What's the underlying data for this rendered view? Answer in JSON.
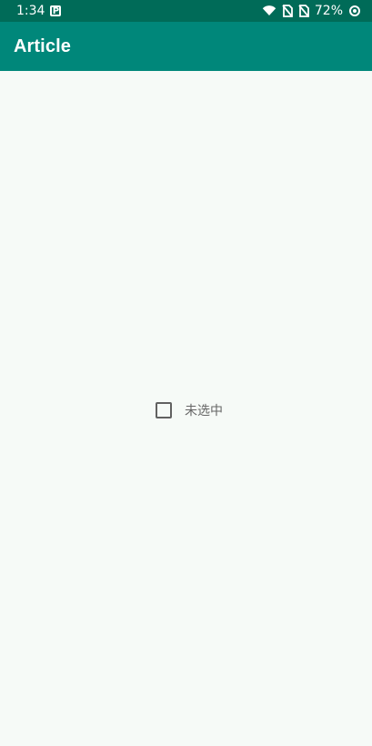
{
  "status_bar": {
    "time": "1:34",
    "app_indicator": "P",
    "battery": "72%",
    "icons": [
      "wifi-icon",
      "no-sim-icon",
      "no-sim-icon",
      "data-saver-icon"
    ]
  },
  "app_bar": {
    "title": "Article"
  },
  "checkbox": {
    "label": "未选中",
    "checked": false
  }
}
